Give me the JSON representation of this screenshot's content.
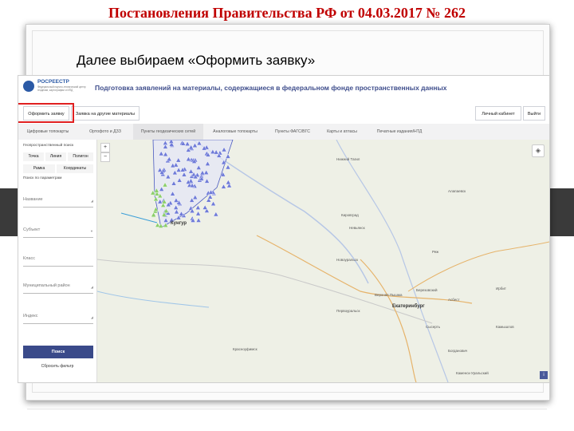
{
  "slide": {
    "title": "Постановления Правительства РФ от 04.03.2017 № 262",
    "subtitle": "Далее выбираем «Оформить заявку»"
  },
  "app": {
    "logo_text": "РОСРЕЕСТР",
    "logo_subtext": "Федеральный научно-технический центр геодезии, картографии и ИПД",
    "header_title": "Подготовка заявлений на материалы, содержащиеся в федеральном фонде пространственных данных",
    "actions": {
      "apply": "Оформить заявку",
      "apply_other": "Заявка на другие материалы",
      "cabinet": "Личный кабинет",
      "logout": "Выйти"
    },
    "tabs": [
      "Цифровые топокарты",
      "Ортофото и ДЗЗ",
      "Пункты геодезических сетей",
      "Аналоговые топокарты",
      "Пункты ФАГС/ВГС",
      "Карты и атласы",
      "Печатные издания/НТД"
    ],
    "active_tab_index": 2,
    "sidebar": {
      "geo_search_label": "Геопространственный поиск",
      "geo_modes": [
        "Точка",
        "Линия",
        "Полигон",
        "Рамка",
        "Координаты"
      ],
      "param_search_label": "Поиск по параметрам",
      "fields": [
        "Название",
        "Субъект",
        "Класс",
        "Муниципальный район",
        "Индекс"
      ],
      "search_button": "Поиск",
      "reset_link": "Сбросить фильтр"
    },
    "map": {
      "zoom_in": "+",
      "zoom_out": "−",
      "layers_icon": "layers-icon",
      "info_label": "i",
      "main_cities": [
        "Кунгур",
        "Екатеринбург"
      ],
      "towns": [
        "Нижний Тагил",
        "Алапаевск",
        "Кировград",
        "Невьянск",
        "Новоуральск",
        "Реж",
        "Березовский",
        "Асбест",
        "Первоуральск",
        "Верхняя Пышма",
        "Сысерть",
        "Каменск-Уральский",
        "Красноуфимск",
        "Камышлов",
        "Богданович",
        "Ирбит"
      ]
    },
    "colors": {
      "header_blue": "#3f4e8c",
      "search_button": "#3a4a8a",
      "highlight_red": "#e02020",
      "title_red": "#c00000",
      "point_fill": "#6f7bd8",
      "green_point": "#8ccf6a"
    }
  }
}
